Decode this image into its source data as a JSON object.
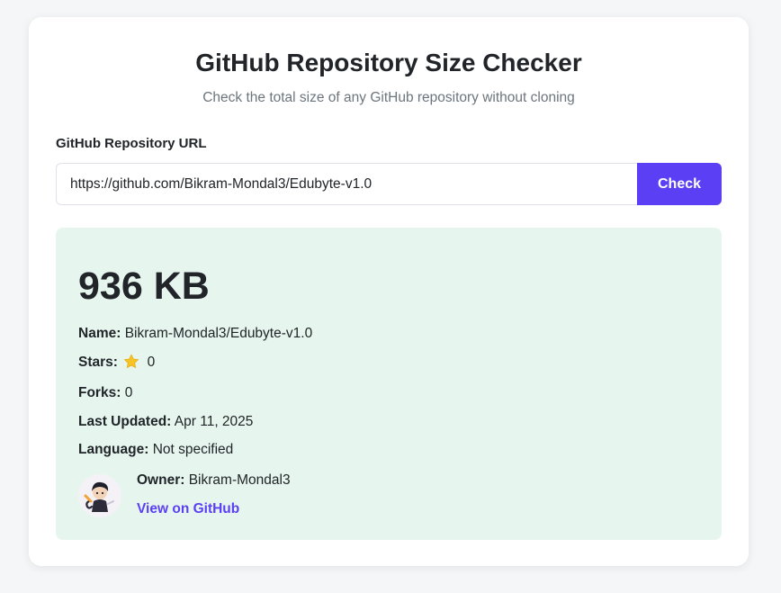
{
  "header": {
    "title": "GitHub Repository Size Checker",
    "subtitle": "Check the total size of any GitHub repository without cloning"
  },
  "form": {
    "label": "GitHub Repository URL",
    "url_value": "https://github.com/Bikram-Mondal3/Edubyte-v1.0",
    "check_label": "Check"
  },
  "result": {
    "size": "936 KB",
    "name_label": "Name:",
    "name_value": "Bikram-Mondal3/Edubyte-v1.0",
    "stars_label": "Stars:",
    "stars_icon": "star-icon",
    "stars_value": "0",
    "forks_label": "Forks:",
    "forks_value": "0",
    "updated_label": "Last Updated:",
    "updated_value": "Apr 11, 2025",
    "language_label": "Language:",
    "language_value": "Not specified",
    "owner_label": "Owner:",
    "owner_value": "Bikram-Mondal3",
    "link_label": "View on GitHub"
  },
  "colors": {
    "accent": "#5b3ff5",
    "result_bg": "#e6f6ee",
    "page_bg": "#f5f6f8",
    "star": "#f7c325"
  }
}
